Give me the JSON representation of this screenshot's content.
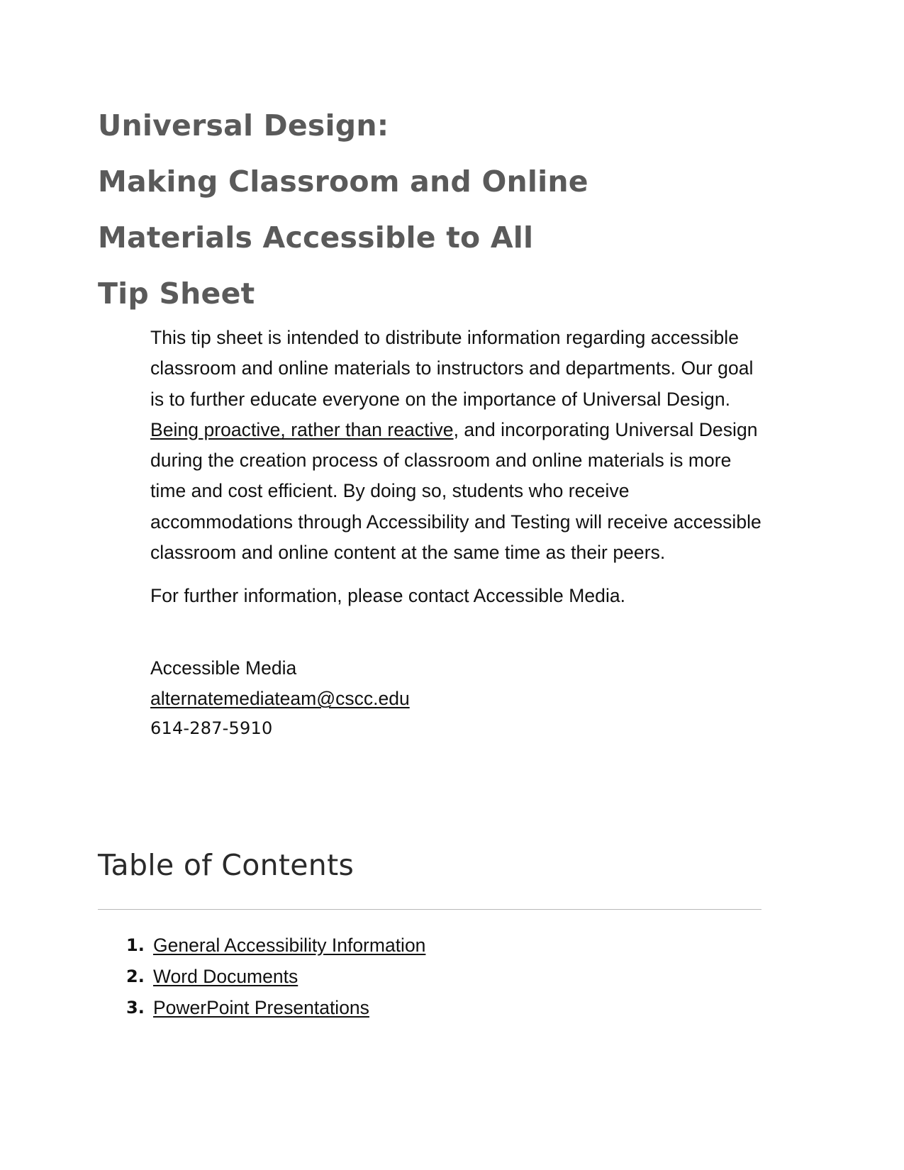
{
  "document": {
    "title_lines": [
      "Universal Design:",
      "Making Classroom and Online",
      "Materials Accessible to All",
      "Tip Sheet"
    ],
    "title_color": "#5a5a5a"
  },
  "intro": {
    "paragraph_part1": "This tip sheet is intended to distribute information regarding accessible classroom and online materials to instructors and departments. Our goal is to further educate everyone on the importance of Universal Design. ",
    "underlined_phrase": "Being proactive, rather than reactive",
    "paragraph_part2": ", and incorporating Universal Design during the creation process of classroom and online materials is more time and cost efficient. By doing so, students who receive accommodations through Accessibility and Testing will receive accessible classroom and online content at the same time as their peers.",
    "contact_sentence": "For further information, please contact Accessible Media."
  },
  "contact": {
    "department": "Accessible Media",
    "email": "alternatemediateam@cscc.edu",
    "phone": "614-287-5910"
  },
  "toc": {
    "heading": "Table of Contents",
    "items": [
      {
        "number": "1.",
        "label": "General Accessibility Information"
      },
      {
        "number": "2.",
        "label": "Word Documents"
      },
      {
        "number": "3.",
        "label": "PowerPoint Presentations"
      }
    ]
  }
}
